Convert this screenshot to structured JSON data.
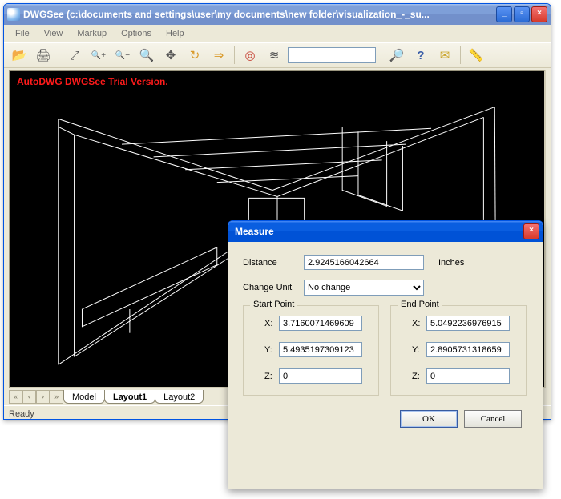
{
  "window": {
    "title": "DWGSee (c:\\documents and settings\\user\\my documents\\new folder\\visualization_-_su...",
    "minimize": "_",
    "maximize": "▫",
    "close": "×"
  },
  "menu": {
    "items": [
      "File",
      "View",
      "Markup",
      "Options",
      "Help"
    ]
  },
  "toolbar": {
    "icons": [
      {
        "name": "open-icon",
        "glyph": "📂"
      },
      {
        "name": "print-icon",
        "glyph": "🖨"
      }
    ],
    "zoom_icons": [
      {
        "name": "zoom-fit-icon",
        "glyph": "⤢"
      },
      {
        "name": "zoom-in-icon",
        "glyph": "🔍+"
      },
      {
        "name": "zoom-out-icon",
        "glyph": "🔍−"
      },
      {
        "name": "zoom-icon",
        "glyph": "🔍"
      },
      {
        "name": "pan-icon",
        "glyph": "✥"
      },
      {
        "name": "rotate-icon",
        "glyph": "↻"
      },
      {
        "name": "redo-icon",
        "glyph": "⇒"
      }
    ],
    "misc_icons": [
      {
        "name": "target-icon",
        "glyph": "◎"
      },
      {
        "name": "layers-icon",
        "glyph": "≋"
      }
    ],
    "layer_field": "",
    "right_icons": [
      {
        "name": "find-folder-icon",
        "glyph": "🔎"
      },
      {
        "name": "help-icon",
        "glyph": "?"
      },
      {
        "name": "mail-icon",
        "glyph": "✉"
      }
    ],
    "scale_icon": {
      "name": "scale-icon",
      "glyph": "📏"
    }
  },
  "viewport": {
    "watermark": "AutoDWG DWGSee Trial Version."
  },
  "tabs": {
    "arrows": [
      "«",
      "‹",
      "›",
      "»"
    ],
    "items": [
      {
        "label": "Model",
        "active": false
      },
      {
        "label": "Layout1",
        "active": true
      },
      {
        "label": "Layout2",
        "active": false
      }
    ]
  },
  "status": {
    "text": "Ready"
  },
  "dialog": {
    "title": "Measure",
    "close": "×",
    "distance_label": "Distance",
    "distance_value": "2.9245166042664",
    "distance_unit": "Inches",
    "change_unit_label": "Change Unit",
    "change_unit_value": "No change",
    "start_point_label": "Start Point",
    "end_point_label": "End Point",
    "x_label": "X:",
    "y_label": "Y:",
    "z_label": "Z:",
    "start": {
      "x": "3.7160071469609",
      "y": "5.4935197309123",
      "z": "0"
    },
    "end": {
      "x": "5.0492236976915",
      "y": "2.8905731318659",
      "z": "0"
    },
    "ok": "OK",
    "cancel": "Cancel"
  }
}
